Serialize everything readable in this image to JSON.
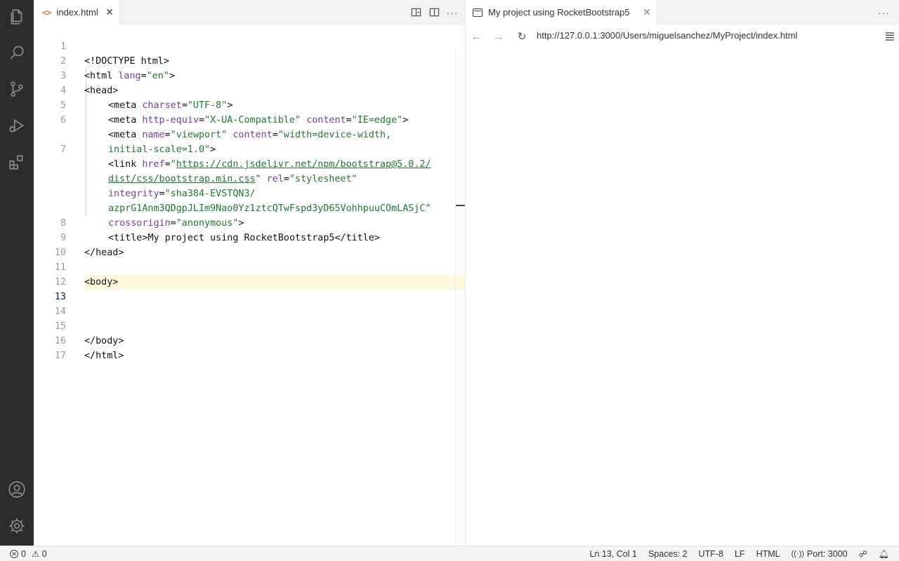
{
  "editor": {
    "tab_label": "index.html",
    "file_icon": "<>",
    "lines": [
      {
        "n": "1"
      },
      {
        "n": "2"
      },
      {
        "n": "3"
      },
      {
        "n": "4"
      },
      {
        "n": "5"
      },
      {
        "n": "6"
      },
      {
        "n": ""
      },
      {
        "n": "7"
      },
      {
        "n": ""
      },
      {
        "n": ""
      },
      {
        "n": ""
      },
      {
        "n": ""
      },
      {
        "n": "8"
      },
      {
        "n": "9"
      },
      {
        "n": "10"
      },
      {
        "n": "11"
      },
      {
        "n": "12"
      },
      {
        "n": "13"
      },
      {
        "n": "14"
      },
      {
        "n": "15"
      },
      {
        "n": "16"
      },
      {
        "n": "17"
      }
    ],
    "code": {
      "l1": "<!DOCTYPE html>",
      "l2_open": "<html ",
      "l2_attr": "lang",
      "l2_val": "\"en\"",
      "l2_close": ">",
      "l3": "<head>",
      "l4a": "<meta ",
      "l4b": "charset",
      "l4c": "\"UTF-8\"",
      "l4d": ">",
      "l5a": "<meta ",
      "l5b": "http-equiv",
      "l5c": "\"X-UA-Compatible\"",
      "l5d": " ",
      "l5e": "content",
      "l5f": "\"IE=edge\"",
      "l5g": ">",
      "l6a": "<meta ",
      "l6b": "name",
      "l6c": "\"viewport\"",
      "l6d": " ",
      "l6e": "content",
      "l6f": "\"width=device-width,",
      "l6g": "initial-scale=1.0\"",
      "l6h": ">",
      "l7a": "<link ",
      "l7b": "href",
      "l7c": "\"",
      "l7d": "https://cdn.jsdelivr.net/npm/bootstrap@5.0.2/",
      "l7e": "dist/css/bootstrap.min.css",
      "l7f": "\"",
      "l7g": " ",
      "l7h": "rel",
      "l7i": "\"stylesheet\"",
      "l7j": "integrity",
      "l7k": "\"sha384-EVSTQN3/",
      "l7l": "azprG1Anm3QDgpJLIm9Nao0Yz1ztcQTwFspd3yD65VohhpuuCOmLASjC\"",
      "l7m": "crossorigin",
      "l7n": "\"anonymous\"",
      "l7o": ">",
      "l8a": "<title>",
      "l8b": "My project using RocketBootstrap5",
      "l8c": "</title>",
      "l9": "</head>",
      "l11": "<body>",
      "l15": "</body>",
      "l16": "</html>"
    }
  },
  "preview": {
    "tab_label": "My project using RocketBootstrap5",
    "url": "http://127.0.0.1:3000/Users/miguelsanchez/MyProject/index.html",
    "back_icon": "←",
    "forward_icon": "→",
    "reload_icon": "↻",
    "more_icon": "···"
  },
  "statusbar": {
    "errors": "0",
    "warnings": "0",
    "position": "Ln 13, Col 1",
    "spaces": "Spaces: 2",
    "encoding": "UTF-8",
    "eol": "LF",
    "language": "HTML",
    "port": "Port: 3000"
  },
  "icons": {
    "explorer": "files-icon",
    "search": "search-icon",
    "scm": "source-control-icon",
    "run": "run-debug-icon",
    "extensions": "extensions-icon",
    "accounts": "account-icon",
    "settings": "gear-icon"
  }
}
